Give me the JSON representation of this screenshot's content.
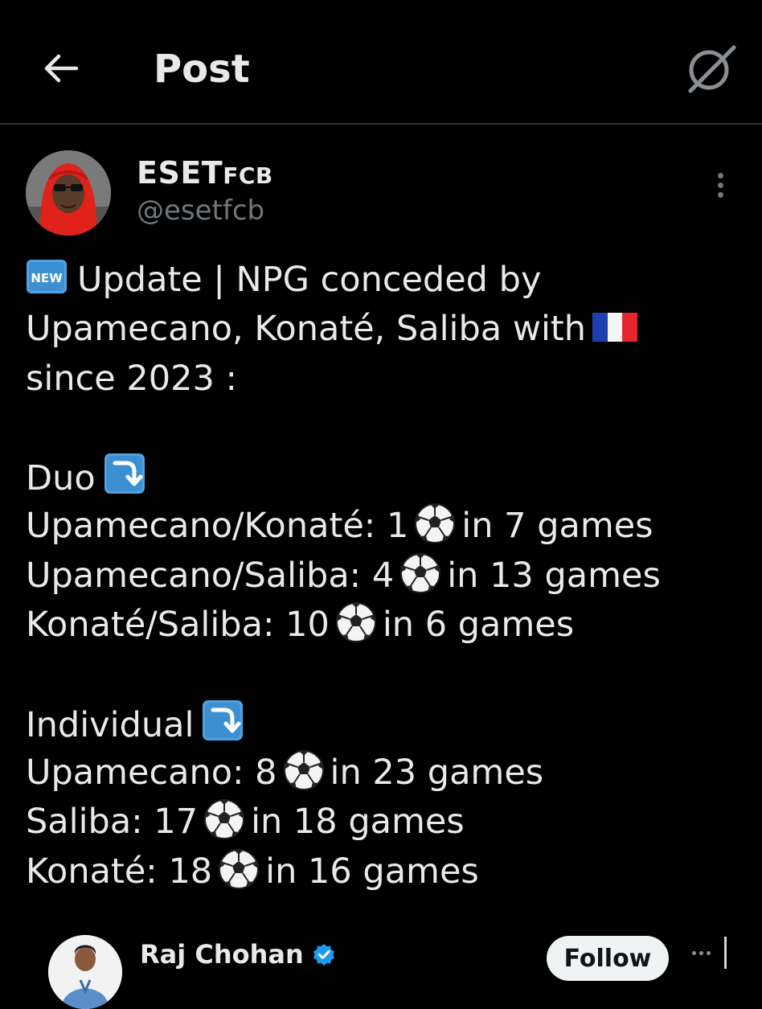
{
  "header": {
    "title": "Post",
    "back_icon": "arrow-left-icon",
    "grok_icon": "grok-icon"
  },
  "author": {
    "display_name_prefix": "ESET",
    "display_name_suffix": "FCB",
    "handle": "@esetfcb"
  },
  "post": {
    "line1": "Update | NPG conceded by",
    "line2": "Upamecano, Konaté, Saliba with",
    "line3": "since 2023 :",
    "duo_heading": "Duo",
    "duo": [
      {
        "label": "Upamecano/Konaté: 1",
        "suffix": "in 7 games"
      },
      {
        "label": "Upamecano/Saliba: 4",
        "suffix": "in 13 games"
      },
      {
        "label": "Konaté/Saliba: 10",
        "suffix": "in 6 games"
      }
    ],
    "individual_heading": "Individual",
    "individual": [
      {
        "label": "Upamecano: 8",
        "suffix": "in 23 games"
      },
      {
        "label": "Saliba: 17",
        "suffix": "in 18 games"
      },
      {
        "label": "Konaté: 18",
        "suffix": "in 16 games"
      }
    ],
    "emoji_new_text": "NEW"
  },
  "suggested": {
    "name": "Raj Chohan",
    "follow_label": "Follow"
  },
  "colors": {
    "background": "#000000",
    "text": "#e7e9ea",
    "muted": "#71767b",
    "divider": "#2f3336",
    "verified": "#1d9bf0",
    "new_badge": "#4fa3e0",
    "arrow_badge": "#4fa3e0"
  }
}
